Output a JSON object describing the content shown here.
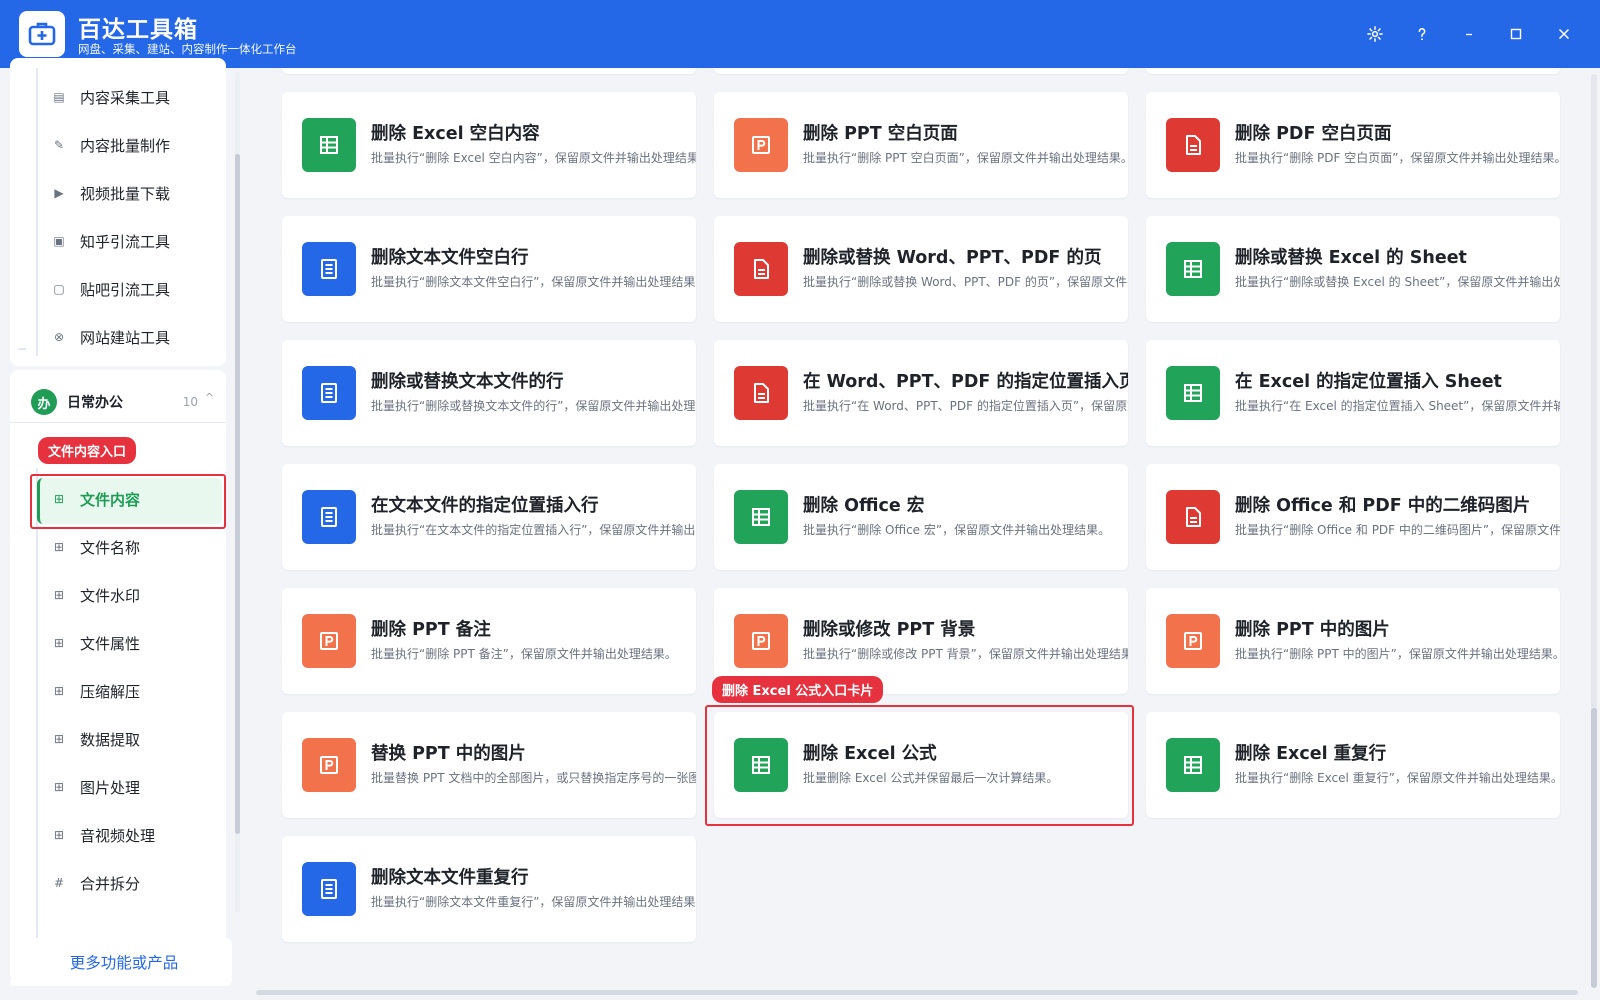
{
  "app": {
    "title": "百达工具箱",
    "subtitle": "网盘、采集、建站、内容制作一体化工作台"
  },
  "sidebar": {
    "top_items": [
      {
        "label": "内容采集工具",
        "icon": "collect-icon"
      },
      {
        "label": "内容批量制作",
        "icon": "pen-icon"
      },
      {
        "label": "视频批量下载",
        "icon": "video-icon"
      },
      {
        "label": "知乎引流工具",
        "icon": "zhihu-icon"
      },
      {
        "label": "贴吧引流工具",
        "icon": "tieba-icon"
      },
      {
        "label": "网站建站工具",
        "icon": "website-icon"
      }
    ],
    "group": {
      "badge": "办",
      "title": "日常办公",
      "count": "10"
    },
    "highlight_tag": "文件内容入口",
    "office_items": [
      {
        "label": "文件内容",
        "icon": "grid-icon"
      },
      {
        "label": "文件名称",
        "icon": "grid-icon"
      },
      {
        "label": "文件水印",
        "icon": "grid-icon"
      },
      {
        "label": "文件属性",
        "icon": "grid-icon"
      },
      {
        "label": "压缩解压",
        "icon": "grid-icon"
      },
      {
        "label": "数据提取",
        "icon": "grid-icon"
      },
      {
        "label": "图片处理",
        "icon": "grid-icon"
      },
      {
        "label": "音视频处理",
        "icon": "grid-icon"
      },
      {
        "label": "合并拆分",
        "icon": "hash-icon"
      }
    ],
    "more_button": "更多功能或产品"
  },
  "main": {
    "highlight_tag": "删除 Excel 公式入口卡片",
    "cards": [
      {
        "title": "删除 Excel 空白内容",
        "desc": "批量执行“删除 Excel 空白内容”，保留原文件并输出处理结果。",
        "icon": "excel-icon",
        "color": "#22a35a"
      },
      {
        "title": "删除 PPT 空白页面",
        "desc": "批量执行“删除 PPT 空白页面”，保留原文件并输出处理结果。",
        "icon": "ppt-icon",
        "color": "#f2724b"
      },
      {
        "title": "删除 PDF 空白页面",
        "desc": "批量执行“删除 PDF 空白页面”，保留原文件并输出处理结果。",
        "icon": "pdf-icon",
        "color": "#de3a33"
      },
      {
        "title": "删除文本文件空白行",
        "desc": "批量执行“删除文本文件空白行”，保留原文件并输出处理结果。",
        "icon": "text-file-icon",
        "color": "#2468e8"
      },
      {
        "title": "删除或替换 Word、PPT、PDF 的页",
        "desc": "批量执行“删除或替换 Word、PPT、PDF 的页”，保留原文件并输出",
        "icon": "pdf-icon",
        "color": "#de3a33"
      },
      {
        "title": "删除或替换 Excel 的 Sheet",
        "desc": "批量执行“删除或替换 Excel 的 Sheet”，保留原文件并输出处理结果",
        "icon": "excel-icon",
        "color": "#22a35a"
      },
      {
        "title": "删除或替换文本文件的行",
        "desc": "批量执行“删除或替换文本文件的行”，保留原文件并输出处理结果",
        "icon": "text-file-icon",
        "color": "#2468e8"
      },
      {
        "title": "在 Word、PPT、PDF 的指定位置插入页",
        "desc": "批量执行“在 Word、PPT、PDF 的指定位置插入页”，保留原文件",
        "icon": "pdf-icon",
        "color": "#de3a33"
      },
      {
        "title": "在 Excel 的指定位置插入 Sheet",
        "desc": "批量执行“在 Excel 的指定位置插入 Sheet”，保留原文件并输出处理",
        "icon": "excel-icon",
        "color": "#22a35a"
      },
      {
        "title": "在文本文件的指定位置插入行",
        "desc": "批量执行“在文本文件的指定位置插入行”，保留原文件并输出处理",
        "icon": "text-file-icon",
        "color": "#2468e8"
      },
      {
        "title": "删除 Office 宏",
        "desc": "批量执行“删除 Office 宏”，保留原文件并输出处理结果。",
        "icon": "excel-icon",
        "color": "#22a35a"
      },
      {
        "title": "删除 Office 和 PDF 中的二维码图片",
        "desc": "批量执行“删除 Office 和 PDF 中的二维码图片”，保留原文件并输出",
        "icon": "pdf-icon",
        "color": "#de3a33"
      },
      {
        "title": "删除 PPT 备注",
        "desc": "批量执行“删除 PPT 备注”，保留原文件并输出处理结果。",
        "icon": "ppt-icon",
        "color": "#f2724b"
      },
      {
        "title": "删除或修改 PPT 背景",
        "desc": "批量执行“删除或修改 PPT 背景”，保留原文件并输出处理结果。",
        "icon": "ppt-icon",
        "color": "#f2724b"
      },
      {
        "title": "删除 PPT 中的图片",
        "desc": "批量执行“删除 PPT 中的图片”，保留原文件并输出处理结果。",
        "icon": "ppt-icon",
        "color": "#f2724b"
      },
      {
        "title": "替换 PPT 中的图片",
        "desc": "批量替换 PPT 文档中的全部图片，或只替换指定序号的一张图片",
        "icon": "ppt-icon",
        "color": "#f2724b"
      },
      {
        "title": "删除 Excel 公式",
        "desc": "批量删除 Excel 公式并保留最后一次计算结果。",
        "icon": "excel-icon",
        "color": "#22a35a"
      },
      {
        "title": "删除 Excel 重复行",
        "desc": "批量执行“删除 Excel 重复行”，保留原文件并输出处理结果。",
        "icon": "excel-icon",
        "color": "#22a35a"
      },
      {
        "title": "删除文本文件重复行",
        "desc": "批量执行“删除文本文件重复行”，保留原文件并输出处理结果。",
        "icon": "text-file-icon",
        "color": "#2468e8"
      }
    ]
  }
}
